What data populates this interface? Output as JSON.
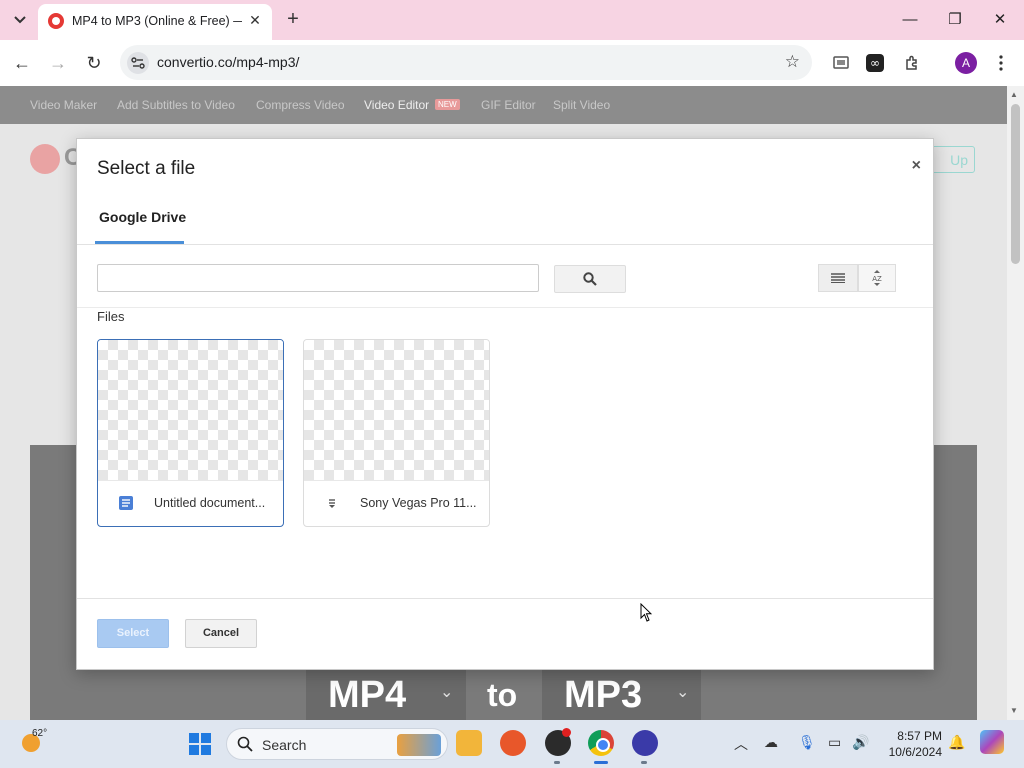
{
  "browser": {
    "tab_title": "MP4 to MP3 (Online & Free) —",
    "url": "convertio.co/mp4-mp3/",
    "avatar_initial": "A",
    "accent_color": "#f7d4e3"
  },
  "site": {
    "nav_items": [
      "Video Maker",
      "Add Subtitles to Video",
      "Compress Video",
      "Video Editor",
      "GIF Editor",
      "Split Video"
    ],
    "new_badge": "NEW",
    "logo_letter": "C",
    "signup_partial": "Up",
    "from_format": "MP4",
    "to_word": "to",
    "to_format": "MP3"
  },
  "modal": {
    "title": "Select a file",
    "tab_label": "Google Drive",
    "search_value": "",
    "files_label": "Files",
    "files": [
      {
        "name": "Untitled document...",
        "icon": "google-docs-icon",
        "selected": true
      },
      {
        "name": "Sony Vegas Pro 11...",
        "icon": "file-generic-icon",
        "selected": false
      }
    ],
    "select_label": "Select",
    "cancel_label": "Cancel",
    "select_color": "#a9caf2"
  },
  "taskbar": {
    "weather_temp": "62°",
    "search_label": "Search",
    "time": "8:57 PM",
    "date": "10/6/2024"
  }
}
